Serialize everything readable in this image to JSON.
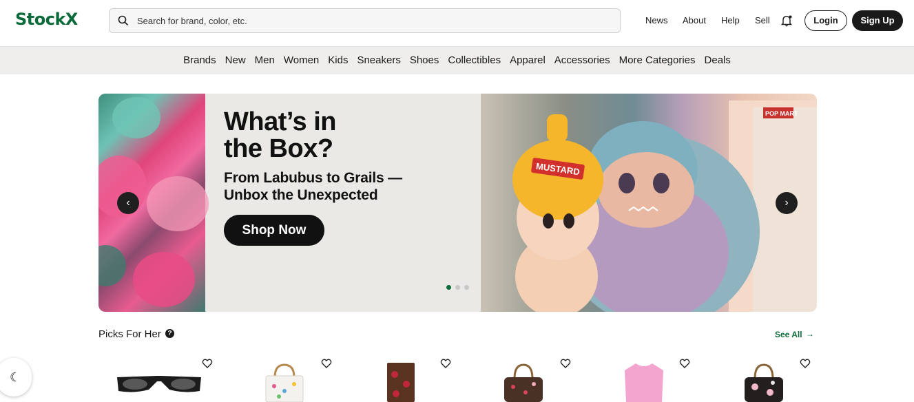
{
  "header": {
    "logo": "StockX",
    "search_placeholder": "Search for brand, color, etc.",
    "links": [
      "News",
      "About",
      "Help",
      "Sell"
    ],
    "login_label": "Login",
    "signup_label": "Sign Up"
  },
  "categories": [
    "Brands",
    "New",
    "Men",
    "Women",
    "Kids",
    "Sneakers",
    "Shoes",
    "Collectibles",
    "Apparel",
    "Accessories",
    "More Categories",
    "Deals"
  ],
  "hero": {
    "title_line1": "What’s in",
    "title_line2": "the Box?",
    "subtitle_line1": "From Labubus to Grails —",
    "subtitle_line2": "Unbox the Unexpected",
    "cta_label": "Shop Now",
    "slide_index": 1,
    "slide_count": 3,
    "product_box_text": "POP MART",
    "mustard_label": "MUSTARD"
  },
  "picks": {
    "title": "Picks For Her",
    "see_all_label": "See All",
    "products": [
      {
        "icon": "sunglasses-icon"
      },
      {
        "icon": "handbag-white-icon"
      },
      {
        "icon": "phone-case-icon"
      },
      {
        "icon": "handbag-brown-icon"
      },
      {
        "icon": "pink-sweater-icon"
      },
      {
        "icon": "handbag-black-icon"
      }
    ]
  },
  "colors": {
    "brand": "#0b6b3a",
    "dark": "#1a1a1a",
    "nav_bg": "#efeeec"
  }
}
